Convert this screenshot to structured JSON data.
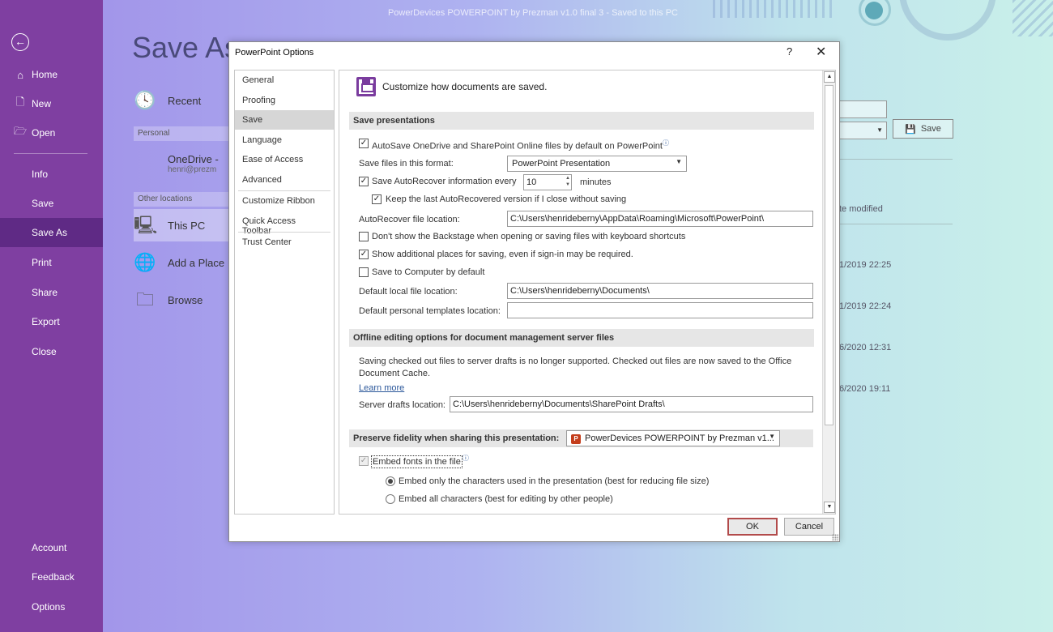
{
  "window_title": "PowerDevices POWERPOINT by Prezman v1.0 final 3  -  Saved to this PC",
  "sidebar": {
    "items": [
      {
        "label": "Home",
        "icon": "home-icon",
        "glyph": "⌂"
      },
      {
        "label": "New",
        "icon": "new-document-icon",
        "glyph": "🗋"
      },
      {
        "label": "Open",
        "icon": "open-folder-icon",
        "glyph": "🗁"
      },
      {
        "label": "Info"
      },
      {
        "label": "Save"
      },
      {
        "label": "Save As"
      },
      {
        "label": "Print"
      },
      {
        "label": "Share"
      },
      {
        "label": "Export"
      },
      {
        "label": "Close"
      },
      {
        "label": "Account"
      },
      {
        "label": "Feedback"
      },
      {
        "label": "Options"
      }
    ],
    "active": "Save As"
  },
  "backstage": {
    "title": "Save As",
    "recent": "Recent",
    "personal_header": "Personal",
    "onedrive_label": "OneDrive - ",
    "onedrive_email": "henri@prezm",
    "other_header": "Other locations",
    "this_pc": "This PC",
    "add_place": "Add a Place",
    "browse": "Browse",
    "save_button": "Save",
    "date_modified": "te modified",
    "dates": [
      "1/2019 22:25",
      "1/2019 22:24",
      "6/2020 12:31",
      "6/2020 19:11"
    ]
  },
  "dialog": {
    "title": "PowerPoint Options",
    "help": "?",
    "close": "✕",
    "categories": [
      "General",
      "Proofing",
      "Save",
      "Language",
      "Ease of Access",
      "Advanced",
      "Customize Ribbon",
      "Quick Access Toolbar",
      "Trust Center"
    ],
    "active_category": "Save",
    "intro": "Customize how documents are saved.",
    "save_presentations": {
      "heading": "Save presentations",
      "autosave_label": "AutoSave OneDrive and SharePoint Online files by default on PowerPoint",
      "autosave_checked": true,
      "format_label": "Save files in this format:",
      "format_value": "PowerPoint Presentation",
      "autorecover_label": "Save AutoRecover information every",
      "autorecover_checked": true,
      "autorecover_minutes": "10",
      "minutes_label": "minutes",
      "keep_last_label": "Keep the last AutoRecovered version if I close without saving",
      "keep_last_checked": true,
      "autorecover_location_label": "AutoRecover file location:",
      "autorecover_location": "C:\\Users\\henrideberny\\AppData\\Roaming\\Microsoft\\PowerPoint\\",
      "no_backstage_label": "Don't show the Backstage when opening or saving files with keyboard shortcuts",
      "no_backstage_checked": false,
      "additional_places_label": "Show additional places for saving, even if sign-in may be required.",
      "additional_places_checked": true,
      "save_to_computer_label": "Save to Computer by default",
      "save_to_computer_checked": false,
      "default_local_label": "Default local file location:",
      "default_local": "C:\\Users\\henrideberny\\Documents\\",
      "templates_label": "Default personal templates location:",
      "templates_location": ""
    },
    "offline": {
      "heading": "Offline editing options for document management server files",
      "notice_line1": "Saving checked out files to server drafts is no longer supported. Checked out files are now saved to the Office",
      "notice_line2": "Document Cache.",
      "learn_more": "Learn more",
      "drafts_label": "Server drafts location:",
      "drafts_location": "C:\\Users\\henrideberny\\Documents\\SharePoint Drafts\\"
    },
    "fidelity": {
      "heading": "Preserve fidelity when sharing this presentation:",
      "presentation": "PowerDevices POWERPOINT by Prezman v1...",
      "embed_label": "Embed fonts in the file",
      "embed_checked": true,
      "embed_only_label": "Embed only the characters used in the presentation (best for reducing file size)",
      "embed_all_label": "Embed all characters (best for editing by other people)",
      "embed_only_selected": true
    },
    "ok": "OK",
    "cancel": "Cancel"
  }
}
